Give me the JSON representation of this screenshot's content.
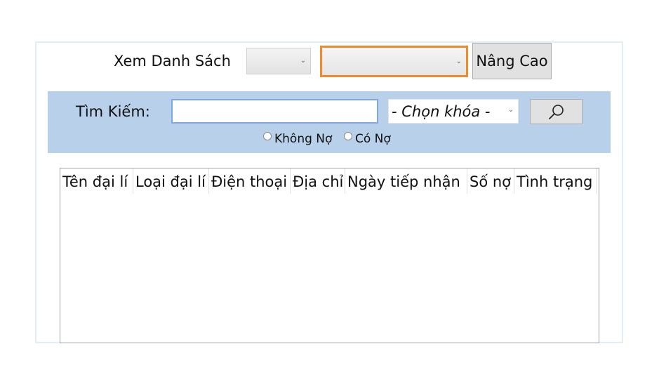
{
  "view_list": {
    "label": "Xem Danh Sách",
    "combo1_value": "",
    "combo2_value": ""
  },
  "advanced_button": "Nâng Cao",
  "search": {
    "label": "Tìm Kiếm:",
    "input_value": "",
    "key_placeholder": "- Chọn khóa -",
    "radio_no_debt": "Không Nợ",
    "radio_has_debt": "Có Nợ"
  },
  "grid": {
    "columns": [
      "Tên đại lí",
      "Loại đại lí",
      "Điện thoại",
      "Địa chỉ",
      "Ngày tiếp nhận",
      "Số nợ",
      "Tình trạng"
    ],
    "rows": []
  },
  "colors": {
    "band": "#b8d0ea",
    "highlight": "#f08a2c",
    "input_border": "#7fa7e3"
  },
  "icons": {
    "search_button": "search-icon",
    "combo_arrow": "chevron-down-icon"
  }
}
